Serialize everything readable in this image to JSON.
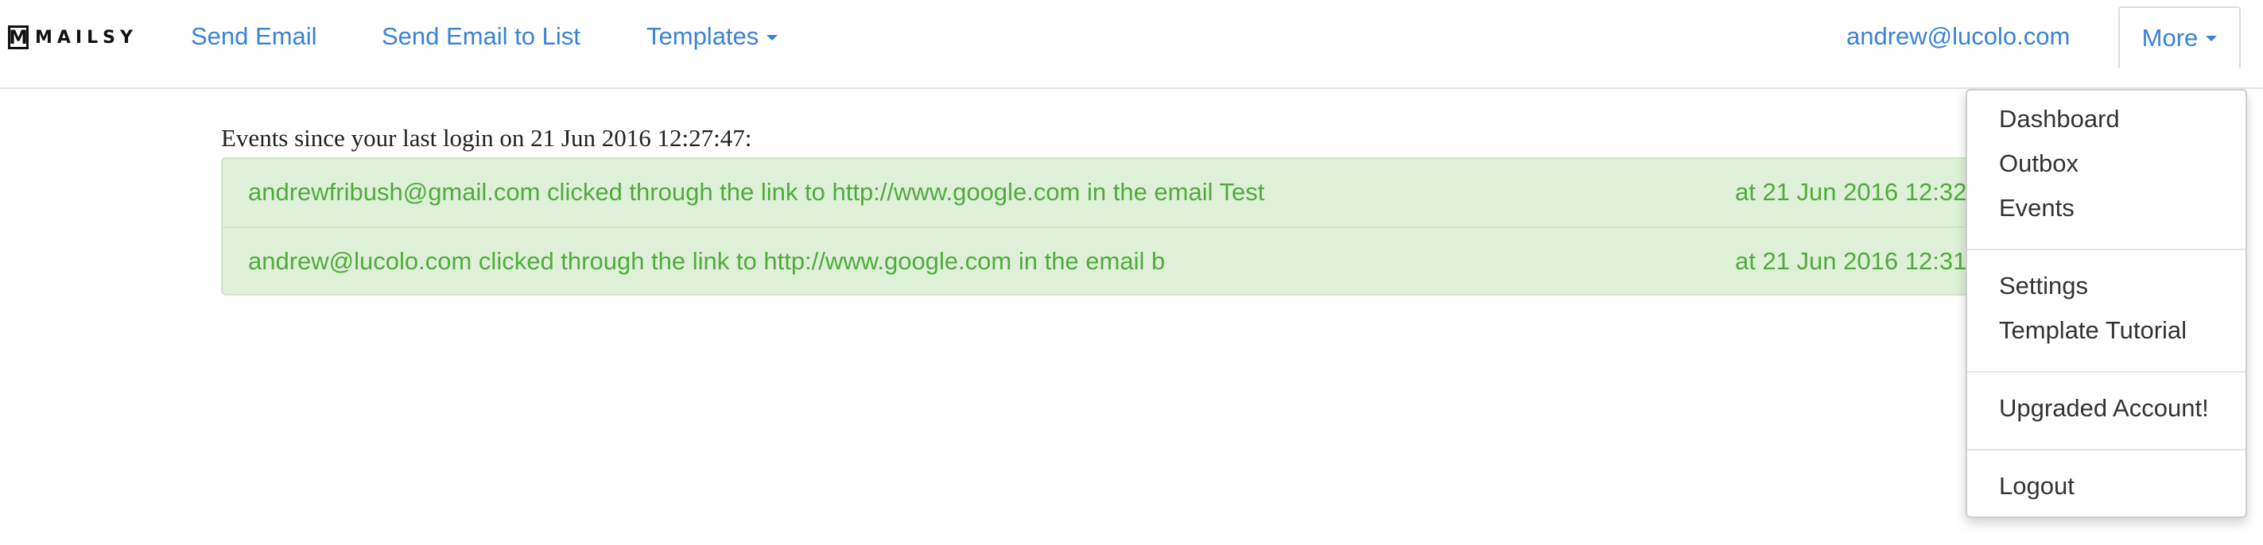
{
  "brand": {
    "logo_letter": "M",
    "name": "MAILSY"
  },
  "nav": {
    "send_email": "Send Email",
    "send_email_to_list": "Send Email to List",
    "templates": "Templates",
    "user_email": "andrew@lucolo.com",
    "more": "More"
  },
  "events": {
    "intro": "Events since your last login on 21 Jun 2016 12:27:47:",
    "rows": [
      {
        "text": "andrewfribush@gmail.com clicked through the link to http://www.google.com in the email Test",
        "time": "at 21 Jun 2016 12:32"
      },
      {
        "text": "andrew@lucolo.com clicked through the link to http://www.google.com in the email b",
        "time": "at 21 Jun 2016 12:31"
      }
    ]
  },
  "more_menu": {
    "dashboard": "Dashboard",
    "outbox": "Outbox",
    "events": "Events",
    "settings": "Settings",
    "template_tutorial": "Template Tutorial",
    "upgraded_account": "Upgraded Account!",
    "logout": "Logout"
  },
  "colors": {
    "link": "#3a82d6",
    "success_bg": "#dff0d8",
    "success_text": "#4fac3c"
  }
}
